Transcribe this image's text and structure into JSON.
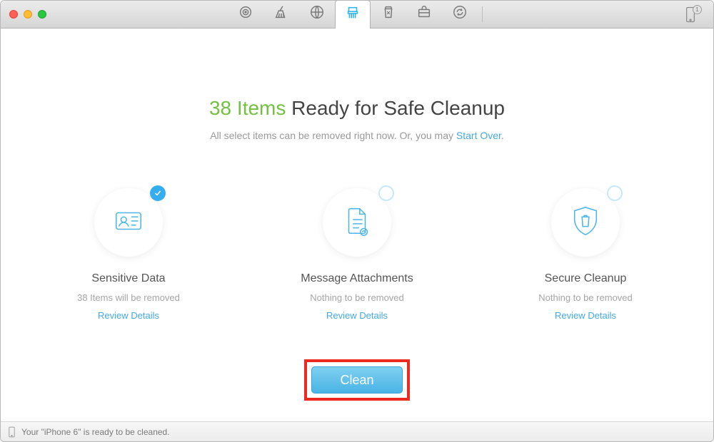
{
  "toolbar": {
    "tools": [
      {
        "name": "target-icon",
        "active": false
      },
      {
        "name": "broom-icon",
        "active": false
      },
      {
        "name": "globe-icon",
        "active": false
      },
      {
        "name": "shredder-icon",
        "active": true
      },
      {
        "name": "recycle-icon",
        "active": false
      },
      {
        "name": "toolbox-icon",
        "active": false
      },
      {
        "name": "sync-icon",
        "active": false
      }
    ],
    "device_badge": "1"
  },
  "headline": {
    "count_text": "38 Items",
    "rest_text": " Ready for Safe Cleanup"
  },
  "subhead": {
    "prefix": "All select items can be removed right now. Or, you may ",
    "link": "Start Over",
    "suffix": "."
  },
  "cards": [
    {
      "id": "sensitive",
      "title": "Sensitive Data",
      "subtitle": "38 Items will be removed",
      "link": "Review Details",
      "selected": true,
      "icon": "id-card-icon"
    },
    {
      "id": "attachments",
      "title": "Message Attachments",
      "subtitle": "Nothing to be removed",
      "link": "Review Details",
      "selected": false,
      "icon": "document-clip-icon"
    },
    {
      "id": "secure",
      "title": "Secure Cleanup",
      "subtitle": "Nothing to be removed",
      "link": "Review Details",
      "selected": false,
      "icon": "shield-trash-icon"
    }
  ],
  "clean_button": "Clean",
  "statusbar": {
    "text": "Your \"iPhone 6\" is ready to be cleaned."
  }
}
